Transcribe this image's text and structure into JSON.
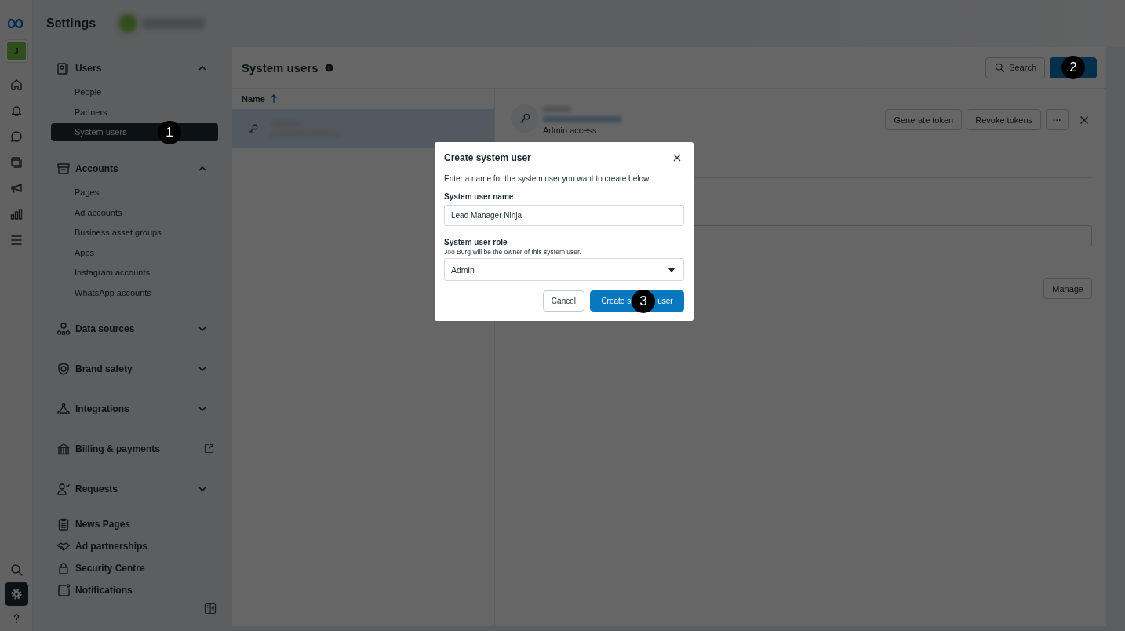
{
  "rail": {
    "top": [
      {
        "kind": "logo"
      },
      {
        "kind": "avatar",
        "label": "J"
      },
      {
        "kind": "home"
      },
      {
        "kind": "bell"
      },
      {
        "kind": "chat"
      },
      {
        "kind": "layers"
      },
      {
        "kind": "megaphone"
      },
      {
        "kind": "chart"
      },
      {
        "kind": "menu"
      }
    ],
    "bottom": [
      {
        "kind": "search",
        "selected": false
      },
      {
        "kind": "gear",
        "selected": true
      },
      {
        "kind": "help",
        "selected": false
      }
    ]
  },
  "header": {
    "title": "Settings"
  },
  "sidebar": {
    "sections": [
      {
        "label": "Users",
        "kind": "group",
        "expanded": true,
        "children": [
          {
            "label": "People",
            "selected": false
          },
          {
            "label": "Partners",
            "selected": false
          },
          {
            "label": "System users",
            "selected": true
          }
        ]
      },
      {
        "label": "Accounts",
        "kind": "group",
        "expanded": true,
        "children": [
          {
            "label": "Pages",
            "selected": false
          },
          {
            "label": "Ad accounts",
            "selected": false
          },
          {
            "label": "Business asset groups",
            "selected": false
          },
          {
            "label": "Apps",
            "selected": false
          },
          {
            "label": "Instagram accounts",
            "selected": false
          },
          {
            "label": "WhatsApp accounts",
            "selected": false
          }
        ]
      },
      {
        "label": "Data sources",
        "kind": "group",
        "expanded": false
      },
      {
        "label": "Brand safety",
        "kind": "group",
        "expanded": false
      },
      {
        "label": "Integrations",
        "kind": "group",
        "expanded": false
      },
      {
        "label": "Billing & payments",
        "kind": "external"
      },
      {
        "label": "Requests",
        "kind": "group",
        "expanded": false
      },
      {
        "label": "News Pages",
        "kind": "plain"
      },
      {
        "label": "Ad partnerships",
        "kind": "plain"
      },
      {
        "label": "Security Centre",
        "kind": "plain"
      },
      {
        "label": "Notifications",
        "kind": "plain"
      }
    ]
  },
  "main": {
    "title": "System users",
    "search": "Search",
    "list": {
      "column": "Name",
      "rows": [
        {
          "selected": true
        }
      ]
    },
    "detail": {
      "subtitle": "Admin access",
      "buttons": [
        "Generate token",
        "Revoke tokens"
      ],
      "more": "···",
      "manage": "Manage"
    }
  },
  "dialog": {
    "title": "Create system user",
    "intro": "Enter a name for the system user you want to create below:",
    "name_label": "System user name",
    "name_value": "Lead Manager Ninja",
    "role_label": "System user role",
    "role_hint": "Joo Burg will be the owner of this system user.",
    "role_value": "Admin",
    "cancel": "Cancel",
    "confirm_start": "Create s",
    "confirm_end": "user"
  },
  "annotations": [
    "1",
    "2",
    "3"
  ]
}
